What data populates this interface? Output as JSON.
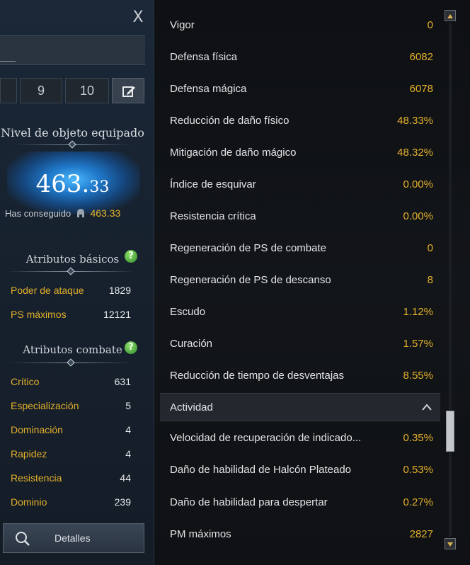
{
  "window": {
    "close_label": "X"
  },
  "presets": {
    "buttons": [
      "9",
      "10"
    ]
  },
  "item_level": {
    "title": "Nivel de objeto equipado",
    "value_big": "463.",
    "value_small": "33",
    "achieved_label": "Has conseguido",
    "achieved_value": "463.33"
  },
  "basic": {
    "title": "Atributos básicos",
    "help": "?",
    "stats": [
      {
        "label": "Poder de ataque",
        "value": "1829"
      },
      {
        "label": "PS máximos",
        "value": "12121"
      }
    ]
  },
  "combat": {
    "title": "Atributos combate",
    "help": "?",
    "stats": [
      {
        "label": "Crítico",
        "value": "631"
      },
      {
        "label": "Especialización",
        "value": "5"
      },
      {
        "label": "Dominación",
        "value": "4"
      },
      {
        "label": "Rapidez",
        "value": "4"
      },
      {
        "label": "Resistencia",
        "value": "44"
      },
      {
        "label": "Dominio",
        "value": "239"
      }
    ]
  },
  "details_button": {
    "label": "Detalles"
  },
  "detail_stats": [
    {
      "label": "Vigor",
      "value": "0"
    },
    {
      "label": "Defensa física",
      "value": "6082"
    },
    {
      "label": "Defensa mágica",
      "value": "6078"
    },
    {
      "label": "Reducción de daño físico",
      "value": "48.33%"
    },
    {
      "label": "Mitigación de daño mágico",
      "value": "48.32%"
    },
    {
      "label": "Índice de esquivar",
      "value": "0.00%"
    },
    {
      "label": "Resistencia crítica",
      "value": "0.00%"
    },
    {
      "label": "Regeneración de PS de combate",
      "value": "0"
    },
    {
      "label": "Regeneración de PS de descanso",
      "value": "8"
    },
    {
      "label": "Escudo",
      "value": "1.12%"
    },
    {
      "label": "Curación",
      "value": "1.57%"
    },
    {
      "label": "Reducción de tiempo de desventajas",
      "value": "8.55%"
    }
  ],
  "activity": {
    "title": "Actividad",
    "stats": [
      {
        "label": "Velocidad de recuperación de indicado...",
        "value": "0.35%"
      },
      {
        "label": "Daño de habilidad de Halcón Plateado",
        "value": "0.53%"
      },
      {
        "label": "Daño de habilidad para despertar",
        "value": "0.27%"
      },
      {
        "label": "PM máximos",
        "value": "2827"
      }
    ]
  },
  "scroll": {
    "position": 0.82
  }
}
